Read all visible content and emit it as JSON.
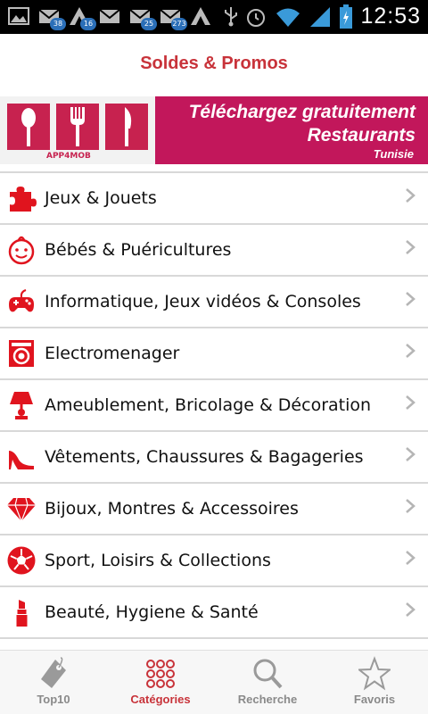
{
  "status_bar": {
    "time": "12:53",
    "notification_badges": [
      "38",
      "16",
      "25",
      "273"
    ],
    "icons": [
      "gallery-icon",
      "mail-icon",
      "arrow-icon",
      "mail-icon",
      "mail-icon",
      "arrow-icon",
      "usb-icon",
      "alarm-icon",
      "wifi-icon",
      "signal-icon",
      "battery-charging-icon"
    ]
  },
  "header": {
    "title": "Soldes & Promos"
  },
  "banner": {
    "logo_text": "APP4MOB",
    "line1": "Téléchargez gratuitement",
    "line2": "Restaurants",
    "line3": "Tunisie"
  },
  "categories": [
    {
      "label": "Jeux & Jouets",
      "icon": "puzzle-icon"
    },
    {
      "label": "Bébés & Puéricultures",
      "icon": "baby-icon"
    },
    {
      "label": "Informatique, Jeux vidéos & Consoles",
      "icon": "gamepad-icon"
    },
    {
      "label": "Electromenager",
      "icon": "washing-machine-icon"
    },
    {
      "label": "Ameublement, Bricolage & Décoration",
      "icon": "lamp-icon"
    },
    {
      "label": "Vêtements, Chaussures & Bagageries",
      "icon": "high-heel-icon"
    },
    {
      "label": "Bijoux, Montres & Accessoires",
      "icon": "diamond-icon"
    },
    {
      "label": "Sport, Loisirs & Collections",
      "icon": "soccer-ball-icon"
    },
    {
      "label": "Beauté, Hygiene & Santé",
      "icon": "lipstick-icon"
    }
  ],
  "tabs": [
    {
      "label": "Top10",
      "icon": "tag-icon",
      "active": false
    },
    {
      "label": "Catégories",
      "icon": "grid-dots-icon",
      "active": true
    },
    {
      "label": "Recherche",
      "icon": "search-icon",
      "active": false
    },
    {
      "label": "Favoris",
      "icon": "star-icon",
      "active": false
    }
  ],
  "colors": {
    "accent": "#c8333a",
    "banner_bg": "#c2175b",
    "icon_red": "#e0141e",
    "inactive_tab": "#8a8a8a"
  }
}
